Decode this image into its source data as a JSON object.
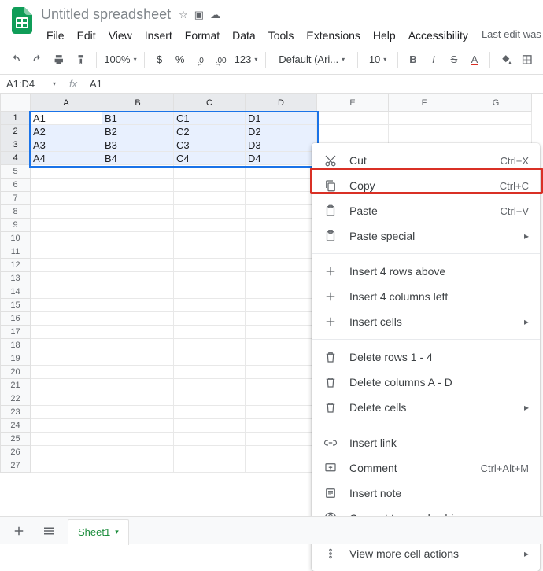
{
  "doc": {
    "title": "Untitled spreadsheet"
  },
  "last_edit": "Last edit was second",
  "menubar": [
    "File",
    "Edit",
    "View",
    "Insert",
    "Format",
    "Data",
    "Tools",
    "Extensions",
    "Help",
    "Accessibility"
  ],
  "toolbar": {
    "zoom": "100%",
    "currency": "$",
    "percent": "%",
    "dec_dec": ".0",
    "inc_dec": ".00",
    "numfmt": "123",
    "font": "Default (Ari...",
    "fontsize": "10",
    "letter_A": "A"
  },
  "namebox": "A1:D4",
  "formula": "A1",
  "columns": [
    "A",
    "B",
    "C",
    "D",
    "E",
    "F",
    "G"
  ],
  "col_selected": [
    "A",
    "B",
    "C",
    "D"
  ],
  "rows_shown": 27,
  "rows_selected": [
    1,
    2,
    3,
    4
  ],
  "cells": {
    "1": [
      "A1",
      "B1",
      "C1",
      "D1",
      "",
      "",
      ""
    ],
    "2": [
      "A2",
      "B2",
      "C2",
      "D2",
      "",
      "",
      ""
    ],
    "3": [
      "A3",
      "B3",
      "C3",
      "D3",
      "",
      "",
      ""
    ],
    "4": [
      "A4",
      "B4",
      "C4",
      "D4",
      "",
      "",
      ""
    ]
  },
  "ctx": {
    "cut": {
      "label": "Cut",
      "short": "Ctrl+X"
    },
    "copy": {
      "label": "Copy",
      "short": "Ctrl+C"
    },
    "paste": {
      "label": "Paste",
      "short": "Ctrl+V"
    },
    "paste_special": {
      "label": "Paste special"
    },
    "ins_rows": {
      "label": "Insert 4 rows above"
    },
    "ins_cols": {
      "label": "Insert 4 columns left"
    },
    "ins_cells": {
      "label": "Insert cells"
    },
    "del_rows": {
      "label": "Delete rows 1 - 4"
    },
    "del_cols": {
      "label": "Delete columns A - D"
    },
    "del_cells": {
      "label": "Delete cells"
    },
    "link": {
      "label": "Insert link"
    },
    "comment": {
      "label": "Comment",
      "short": "Ctrl+Alt+M"
    },
    "note": {
      "label": "Insert note"
    },
    "people": {
      "label": "Convert to people chip"
    },
    "more": {
      "label": "View more cell actions"
    }
  },
  "sheet_tab": "Sheet1"
}
